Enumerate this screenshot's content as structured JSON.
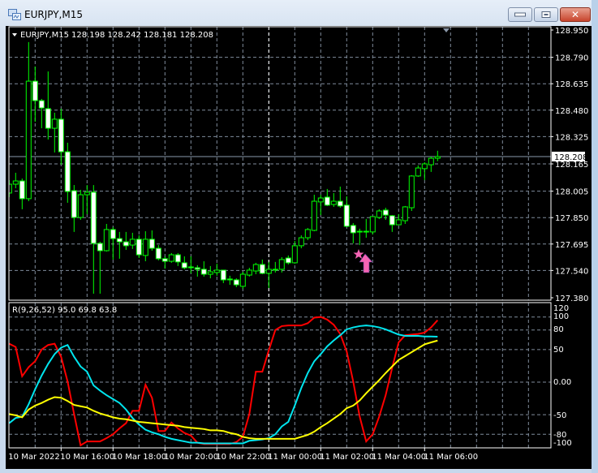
{
  "window": {
    "title": "EURJPY,M15"
  },
  "chart_header": {
    "symbol": "EURJPY,M15",
    "ohlc": "128.198 128.242 128.181 128.208"
  },
  "indicator_header": "R(9,26,52) 95.0 69.8 63.8",
  "colors": {
    "background": "#000000",
    "grid": "#7f8c9c",
    "bull_body": "#000000",
    "bear_body": "#ffffff",
    "candle_outline": "#00ff00",
    "series_fast": "#ff0000",
    "series_mid": "#00e5ee",
    "series_slow": "#ffff00",
    "signal": "#f564b4"
  },
  "chart_data": [
    {
      "type": "candlestick",
      "title": "EURJPY,M15",
      "ylim": [
        127.38,
        128.95
      ],
      "price_ticks": [
        "128.950",
        "128.790",
        "128.635",
        "128.480",
        "128.325",
        "128.165",
        "128.005",
        "127.850",
        "127.695",
        "127.540",
        "127.380"
      ],
      "current_price": "128.208",
      "x_ticks": [
        {
          "index": 0,
          "label": "10 Mar 2022"
        },
        {
          "index": 8,
          "label": "10 Mar 16:00"
        },
        {
          "index": 16,
          "label": "10 Mar 18:00"
        },
        {
          "index": 24,
          "label": "10 Mar 20:00"
        },
        {
          "index": 32,
          "label": "10 Mar 22:00"
        },
        {
          "index": 40,
          "label": "11 Mar 00:00"
        },
        {
          "index": 48,
          "label": "11 Mar 02:00"
        },
        {
          "index": 56,
          "label": "11 Mar 04:00"
        },
        {
          "index": 64,
          "label": "11 Mar 06:00"
        }
      ],
      "day_separator_index": 40,
      "signals": [
        {
          "index": 54,
          "type": "buy-arrow-with-star"
        }
      ],
      "ohlc": [
        [
          127.994,
          128.07,
          127.97,
          128.046
        ],
        [
          128.046,
          128.113,
          128.022,
          128.065
        ],
        [
          128.065,
          128.079,
          127.899,
          127.961
        ],
        [
          127.961,
          128.879,
          127.946,
          128.65
        ],
        [
          128.65,
          128.736,
          128.412,
          128.536
        ],
        [
          128.536,
          128.546,
          128.374,
          128.493
        ],
        [
          128.489,
          128.707,
          128.308,
          128.374
        ],
        [
          128.374,
          128.465,
          128.232,
          128.427
        ],
        [
          128.427,
          128.489,
          128.16,
          128.236
        ],
        [
          128.236,
          128.289,
          127.937,
          128.003
        ],
        [
          128.008,
          128.041,
          127.766,
          127.851
        ],
        [
          127.851,
          128.013,
          127.837,
          127.984
        ],
        [
          127.984,
          128.041,
          127.87,
          127.999
        ],
        [
          127.999,
          128.041,
          127.404,
          127.699
        ],
        [
          127.699,
          127.708,
          127.404,
          127.656
        ],
        [
          127.656,
          127.813,
          127.651,
          127.78
        ],
        [
          127.78,
          127.794,
          127.604,
          127.727
        ],
        [
          127.727,
          127.766,
          127.609,
          127.708
        ],
        [
          127.708,
          127.766,
          127.661,
          127.685
        ],
        [
          127.689,
          127.761,
          127.666,
          127.723
        ],
        [
          127.723,
          127.746,
          127.613,
          127.632
        ],
        [
          127.628,
          127.77,
          127.594,
          127.723
        ],
        [
          127.723,
          127.775,
          127.656,
          127.67
        ],
        [
          127.67,
          127.689,
          127.599,
          127.609
        ],
        [
          127.609,
          127.623,
          127.551,
          127.594
        ],
        [
          127.594,
          127.642,
          127.585,
          127.632
        ],
        [
          127.632,
          127.642,
          127.566,
          127.59
        ],
        [
          127.585,
          127.623,
          127.547,
          127.556
        ],
        [
          127.561,
          127.623,
          127.523,
          127.556
        ],
        [
          127.556,
          127.571,
          127.504,
          127.547
        ],
        [
          127.547,
          127.594,
          127.504,
          127.518
        ],
        [
          127.518,
          127.566,
          127.494,
          127.532
        ],
        [
          127.528,
          127.58,
          127.509,
          127.542
        ],
        [
          127.542,
          127.542,
          127.466,
          127.485
        ],
        [
          127.49,
          127.509,
          127.456,
          127.485
        ],
        [
          127.485,
          127.494,
          127.442,
          127.456
        ],
        [
          127.447,
          127.532,
          127.433,
          127.518
        ],
        [
          127.513,
          127.556,
          127.504,
          127.542
        ],
        [
          127.537,
          127.585,
          127.518,
          127.575
        ],
        [
          127.575,
          127.604,
          127.518,
          127.523
        ],
        [
          127.523,
          127.59,
          127.437,
          127.547
        ],
        [
          127.547,
          127.59,
          127.528,
          127.547
        ],
        [
          127.547,
          127.618,
          127.528,
          127.604
        ],
        [
          127.613,
          127.628,
          127.575,
          127.585
        ],
        [
          127.585,
          127.713,
          127.58,
          127.685
        ],
        [
          127.685,
          127.746,
          127.67,
          127.732
        ],
        [
          127.732,
          127.789,
          127.718,
          127.78
        ],
        [
          127.775,
          127.984,
          127.77,
          127.946
        ],
        [
          127.942,
          127.984,
          127.865,
          127.965
        ],
        [
          127.97,
          128.018,
          127.918,
          127.923
        ],
        [
          127.927,
          127.994,
          127.913,
          127.946
        ],
        [
          127.946,
          128.032,
          127.908,
          127.918
        ],
        [
          127.923,
          127.975,
          127.794,
          127.799
        ],
        [
          127.804,
          127.818,
          127.699,
          127.761
        ],
        [
          127.77,
          127.785,
          127.689,
          127.77
        ],
        [
          127.77,
          127.842,
          127.732,
          127.77
        ],
        [
          127.766,
          127.856,
          127.751,
          127.856
        ],
        [
          127.851,
          127.899,
          127.842,
          127.889
        ],
        [
          127.894,
          127.908,
          127.837,
          127.865
        ],
        [
          127.861,
          127.865,
          127.766,
          127.808
        ],
        [
          127.808,
          127.87,
          127.813,
          127.837
        ],
        [
          127.832,
          127.918,
          127.813,
          127.913
        ],
        [
          127.908,
          128.099,
          127.889,
          128.094
        ],
        [
          128.094,
          128.156,
          128.089,
          128.141
        ],
        [
          128.137,
          128.175,
          128.07,
          128.165
        ],
        [
          128.16,
          128.208,
          128.118,
          128.198
        ],
        [
          128.198,
          128.242,
          128.181,
          128.208
        ]
      ]
    },
    {
      "type": "line",
      "title": "R(9,26,52)",
      "ylim": [
        -100,
        122
      ],
      "y_ticks": [
        "120",
        "100",
        "80",
        "50",
        "0.00",
        "-50",
        "-80",
        "-100"
      ],
      "y_tick_values": [
        120,
        100,
        80,
        50,
        0,
        -50,
        -80,
        -100
      ],
      "grid_levels": [
        100,
        80,
        50,
        0,
        -50,
        -80
      ],
      "series": [
        {
          "name": "R(9)",
          "color": "#ff0000",
          "last": "95.0",
          "values": [
            59,
            54,
            9,
            23,
            32,
            50,
            57,
            59,
            39,
            1,
            -49,
            -97,
            -91,
            -91,
            -91,
            -86,
            -80,
            -71,
            -63,
            -44,
            -44,
            -4,
            -24,
            -75,
            -75,
            -62,
            -71,
            -78,
            -82,
            -93,
            -95,
            -95,
            -95,
            -95,
            -95,
            -92,
            -84,
            -49,
            16,
            16,
            49,
            80,
            86,
            87,
            87,
            87,
            90.5,
            99,
            100,
            96,
            88,
            74,
            47,
            1,
            -53,
            -91,
            -80,
            -53,
            -20,
            22,
            61,
            72,
            73,
            74,
            76,
            84,
            95
          ]
        },
        {
          "name": "R(26)",
          "color": "#00e5ee",
          "last": "69.8",
          "values": [
            -63,
            -55,
            -53,
            -34,
            -11,
            10,
            28,
            43,
            53,
            57,
            39,
            24,
            16,
            -5,
            -13,
            -20,
            -26,
            -32,
            -42,
            -55,
            -65,
            -73,
            -77,
            -80,
            -84,
            -87,
            -89,
            -91,
            -93,
            -93,
            -94,
            -94,
            -94,
            -94,
            -94,
            -94,
            -94,
            -90,
            -89,
            -88,
            -86,
            -80,
            -68,
            -61,
            -36,
            -9,
            14,
            32,
            43,
            55,
            64,
            72,
            81,
            84,
            86,
            87,
            86,
            84,
            81,
            77,
            73,
            71,
            71,
            71,
            70,
            70,
            69.8
          ]
        },
        {
          "name": "R(52)",
          "color": "#ffff00",
          "last": "63.8",
          "values": [
            -49,
            -51,
            -54,
            -42,
            -36,
            -32,
            -27,
            -23,
            -24,
            -29,
            -35,
            -37,
            -39,
            -44,
            -48,
            -51,
            -54,
            -56,
            -57,
            -59,
            -61,
            -62,
            -63,
            -64,
            -65,
            -66,
            -67,
            -69,
            -70,
            -71,
            -72,
            -74,
            -74,
            -75,
            -78,
            -80,
            -84,
            -86,
            -87,
            -87,
            -87,
            -87,
            -87,
            -87,
            -87,
            -84,
            -81,
            -76,
            -69,
            -63,
            -56,
            -49,
            -40,
            -36,
            -28,
            -17,
            -7,
            3,
            14,
            24,
            34,
            40,
            46,
            52,
            58,
            61,
            63.8
          ]
        }
      ]
    }
  ]
}
